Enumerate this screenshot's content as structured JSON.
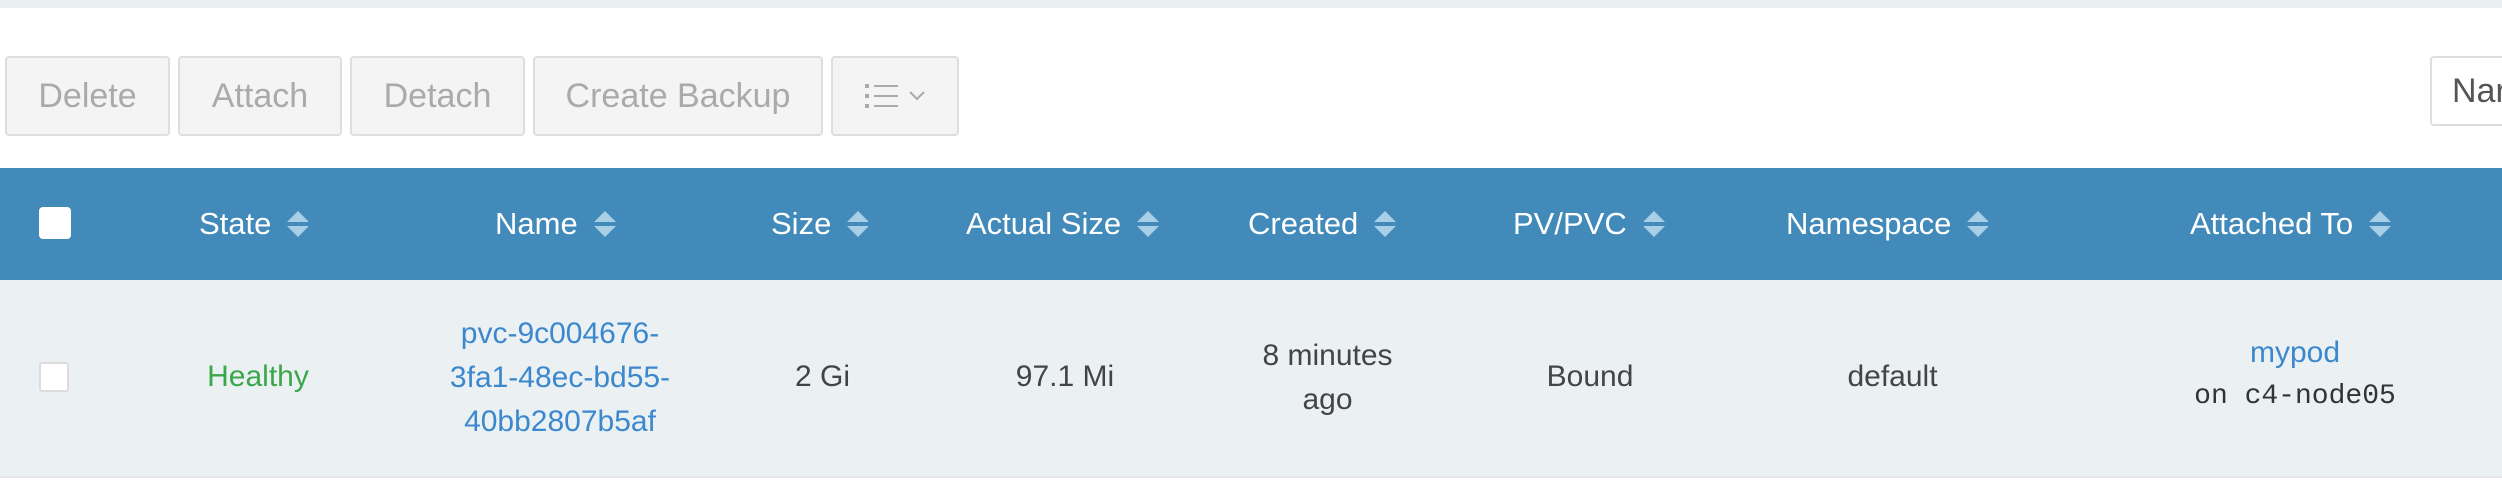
{
  "toolbar": {
    "delete_label": "Delete",
    "attach_label": "Attach",
    "detach_label": "Detach",
    "create_backup_label": "Create Backup",
    "more_icon": "list-icon",
    "more_caret_icon": "chevron-down-icon"
  },
  "search": {
    "visible_text": "Nar"
  },
  "table": {
    "header_color": "#418ab9",
    "columns": [
      "State",
      "Name",
      "Size",
      "Actual Size",
      "Created",
      "PV/PVC",
      "Namespace",
      "Attached To"
    ],
    "rows": [
      {
        "state": "Healthy",
        "name_line1": "pvc-9c004676-",
        "name_line2": "3fa1-48ec-bd55-",
        "name_line3": "40bb2807b5af",
        "size": "2 Gi",
        "actual_size": "97.1 Mi",
        "created_line1": "8 minutes",
        "created_line2": "ago",
        "pv_pvc": "Bound",
        "namespace": "default",
        "attached_pod": "mypod",
        "attached_node": "on c4-node05"
      }
    ]
  }
}
